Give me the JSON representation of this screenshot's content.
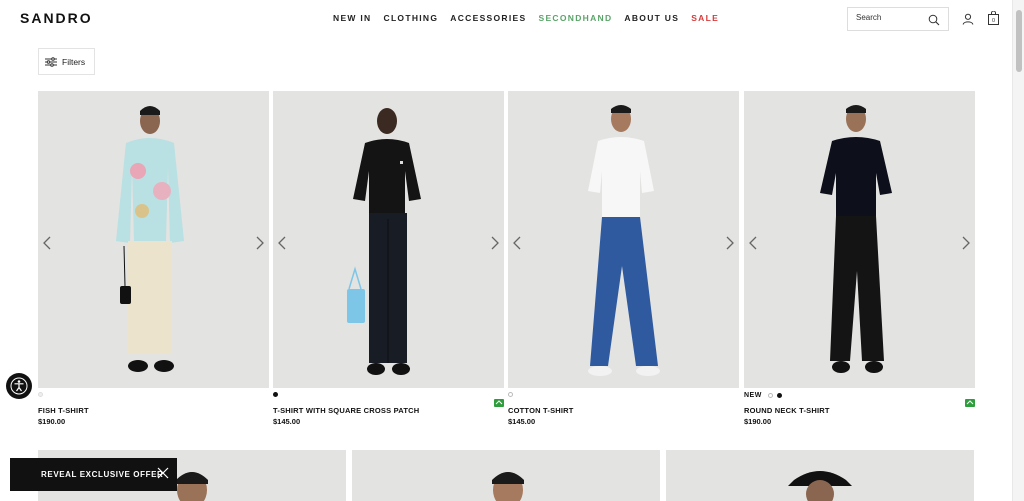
{
  "brand": {
    "logo": "SANDRO"
  },
  "nav": {
    "items": [
      {
        "label": "NEW IN"
      },
      {
        "label": "CLOTHING"
      },
      {
        "label": "ACCESSORIES"
      },
      {
        "label": "SECONDHAND"
      },
      {
        "label": "ABOUT US"
      },
      {
        "label": "SALE"
      }
    ],
    "colors": {
      "secondhand": "#5aa469",
      "sale": "#d83a3a"
    }
  },
  "search": {
    "placeholder": "Search"
  },
  "cart": {
    "count": "0"
  },
  "filters": {
    "label": "Filters"
  },
  "products": [
    {
      "name": "FISH T-SHIRT",
      "price": "$190.00",
      "new_tag": "",
      "swatches": [
        "light"
      ],
      "eco_icon": false
    },
    {
      "name": "T-SHIRT WITH SQUARE CROSS PATCH",
      "price": "$145.00",
      "new_tag": "",
      "swatches": [
        "black"
      ],
      "eco_icon": true
    },
    {
      "name": "COTTON T-SHIRT",
      "price": "$145.00",
      "new_tag": "",
      "swatches": [
        "white"
      ],
      "eco_icon": false
    },
    {
      "name": "ROUND NECK T-SHIRT",
      "price": "$190.00",
      "new_tag": "NEW",
      "swatches": [
        "white",
        "black"
      ],
      "eco_icon": true
    }
  ],
  "offer": {
    "label": "REVEAL EXCLUSIVE OFFER"
  },
  "icons": {
    "search": "search-icon",
    "account": "user-icon",
    "cart": "shopping-bag-icon",
    "filters": "sliders-icon",
    "prev": "chevron-left-icon",
    "next": "chevron-right-icon",
    "eco": "recycle-icon",
    "accessibility": "accessibility-icon",
    "close": "close-icon"
  }
}
